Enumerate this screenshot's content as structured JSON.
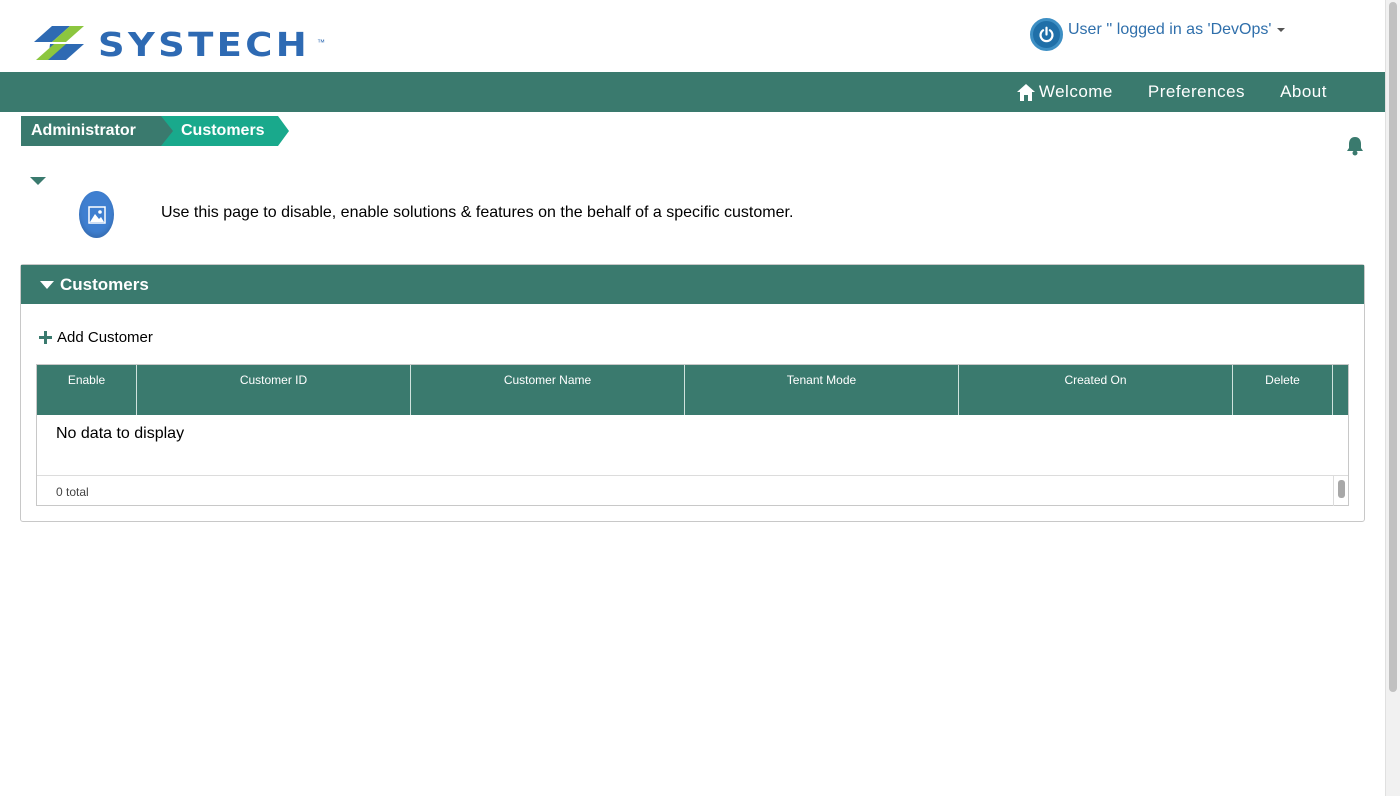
{
  "header": {
    "logo_text": "SYSTECH",
    "logo_tm": "™",
    "user_text": "User '' logged in as 'DevOps'"
  },
  "nav": {
    "welcome": "Welcome",
    "preferences": "Preferences",
    "about": "About"
  },
  "breadcrumb": {
    "items": [
      {
        "label": "Administrator"
      },
      {
        "label": "Customers"
      }
    ]
  },
  "description": "Use this page to disable, enable solutions & features on the behalf of a specific customer.",
  "panel": {
    "title": "Customers",
    "add_label": "Add Customer",
    "columns": [
      "Enable",
      "Customer ID",
      "Customer Name",
      "Tenant Mode",
      "Created On",
      "Delete"
    ],
    "empty_text": "No data to display",
    "total_text": "0 total"
  },
  "colors": {
    "primary": "#3a7a6e",
    "accent": "#19a98c",
    "brand_blue": "#2e6ab3"
  }
}
